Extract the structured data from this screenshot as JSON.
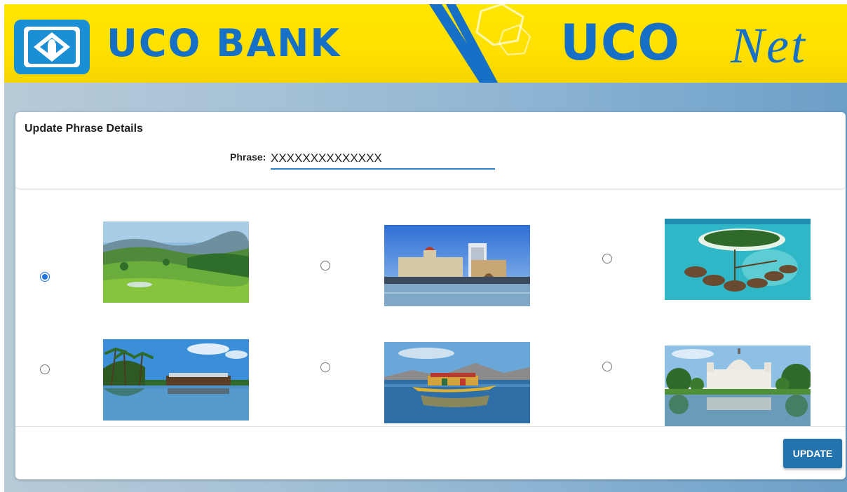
{
  "header": {
    "bank_name": "UCO BANK",
    "net_brand_1": "UCO",
    "net_brand_2": "Net"
  },
  "form": {
    "title": "Update Phrase Details",
    "phrase_label": "Phrase:",
    "phrase_value": "XXXXXXXXXXXXXX",
    "submit_label": "UPDATE"
  },
  "images": [
    {
      "name": "hills-tea-garden",
      "selected": true
    },
    {
      "name": "gateway-of-india",
      "selected": false
    },
    {
      "name": "island-water-villas",
      "selected": false
    },
    {
      "name": "kerala-houseboat",
      "selected": false
    },
    {
      "name": "dal-lake-shikara",
      "selected": false
    },
    {
      "name": "victoria-memorial",
      "selected": false
    }
  ],
  "colors": {
    "brand_blue": "#1670c5",
    "banner_yellow": "#ffe600",
    "button_blue": "#2474b0",
    "input_underline": "#2d82cf"
  }
}
